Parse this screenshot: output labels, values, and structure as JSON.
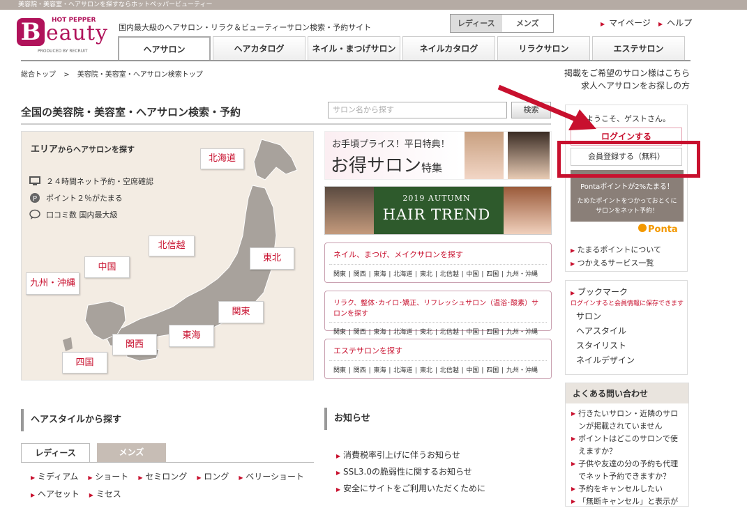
{
  "topbar": {
    "text": "美容院・美容室・ヘアサロンを探すならホットペッパービューティー"
  },
  "logo": {
    "top": "HOT PEPPER",
    "brand": "Beauty",
    "produced": "PRODUCED BY RECRUIT"
  },
  "tagline": "国内最大級のヘアサロン・リラク＆ビューティーサロン検索・予約サイト",
  "gender": {
    "ladies": "レディース",
    "mens": "メンズ"
  },
  "toplinks": {
    "mypage": "マイページ",
    "help": "ヘルプ"
  },
  "tabs": [
    "ヘアサロン",
    "ヘアカタログ",
    "ネイル・まつげサロン",
    "ネイルカタログ",
    "リラクサロン",
    "エステサロン"
  ],
  "breadcrumb": {
    "home": "総合トップ",
    "sep": ">",
    "current": "美容院・美容室・ヘアサロン検索トップ"
  },
  "right_links": {
    "salon": "掲載をご希望のサロン様はこちら",
    "recruit": "求人ヘアサロンをお探しの方"
  },
  "page_title": "全国の美容院・美容室・ヘアサロン検索・予約",
  "search": {
    "placeholder": "サロン名から探す",
    "button": "検索"
  },
  "area": {
    "title_main": "エリア",
    "title_sub": "からヘアサロンを探す",
    "features": [
      "２４時間ネット予約・空席確認",
      "ポイント２％がたまる",
      "口コミ数 国内最大級"
    ],
    "regions": {
      "hokkaido": "北海道",
      "tohoku": "東北",
      "hokushinetsu": "北信越",
      "kanto": "関東",
      "tokai": "東海",
      "kansai": "関西",
      "chugoku": "中国",
      "shikoku": "四国",
      "kyushu": "九州・沖縄"
    }
  },
  "promo1": {
    "line1": "お手頃プライス！平日特典！",
    "line2": "お得サロン",
    "line3": "特集"
  },
  "promo2": {
    "line1": "2019 AUTUMN",
    "line2": "HAIR TREND"
  },
  "pboxes": [
    {
      "title": "ネイル、まつげ、メイクサロンを探す",
      "regions": "関東 | 関西 | 東海 | 北海道 | 東北 | 北信越 | 中国 | 四国 | 九州・沖縄"
    },
    {
      "title": "リラク、整体･カイロ･矯正、リフレッシュサロン（温浴･酸素）サロンを探す",
      "regions": "関東 | 関西 | 東海 | 北海道 | 東北 | 北信越 | 中国 | 四国 | 九州・沖縄"
    },
    {
      "title": "エステサロンを探す",
      "regions": "関東 | 関西 | 東海 | 北海道 | 東北 | 北信越 | 中国 | 四国 | 九州・沖縄"
    }
  ],
  "sidebar": {
    "welcome": "ようこそ、ゲストさん。",
    "login": "ログインする",
    "register": "会員登録する（無料）",
    "ponta_l1": "Pontaポイントが2%たまる！",
    "ponta_l2": "ためたポイントをつかっておとくにサロンをネット予約！",
    "ponta_logo": "Ponta",
    "links": [
      "たまるポイントについて",
      "つかえるサービス一覧"
    ],
    "bookmark_title": "ブックマーク",
    "bookmark_note": "ログインすると会員情報に保存できます",
    "bookmarks": [
      "サロン",
      "ヘアスタイル",
      "スタイリスト",
      "ネイルデザイン"
    ],
    "faq_title": "よくある問い合わせ",
    "faq": [
      "行きたいサロン・近隣のサロンが掲載されていません",
      "ポイントはどこのサロンで使えますか？",
      "子供や友達の分の予約も代理でネット予約できますか？",
      "予約をキャンセルしたい",
      "「無断キャンセル」と表示が"
    ]
  },
  "hairstyle": {
    "title": "ヘアスタイルから探す",
    "tab_ladies": "レディース",
    "tab_mens": "メンズ",
    "items": [
      "ミディアム",
      "ショート",
      "セミロング",
      "ロング",
      "ベリーショート",
      "ヘアセット",
      "ミセス"
    ]
  },
  "news": {
    "title": "お知らせ",
    "items": [
      "消費税率引上げに伴うお知らせ",
      "SSL3.0の脆弱性に関するお知らせ",
      "安全にサイトをご利用いただくために"
    ]
  },
  "colors": {
    "accent": "#c8102e",
    "brand": "#b0125a"
  }
}
